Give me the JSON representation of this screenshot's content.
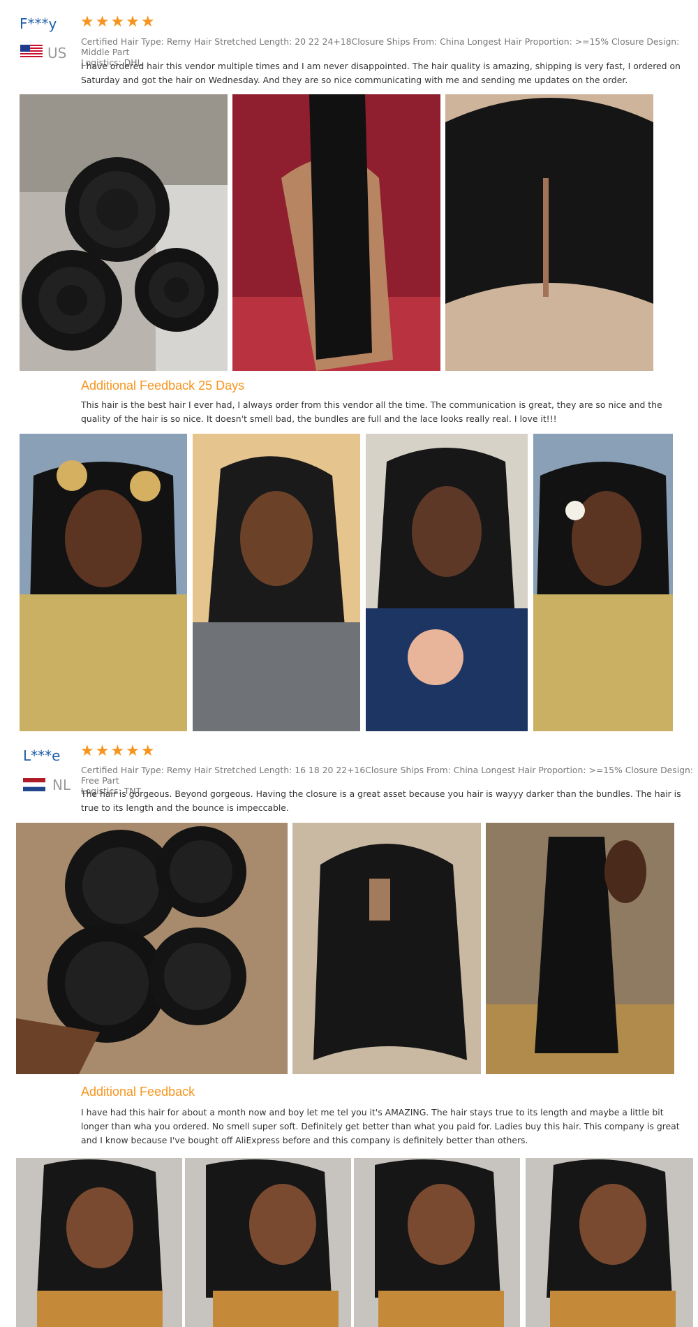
{
  "review1": {
    "reviewer": "F***y",
    "country": "US",
    "stars": "★★★★★",
    "specs": "Certified Hair Type: Remy Hair Stretched Length: 20 22 24+18Closure Ships From: China Longest Hair Proportion: >=15% Closure Design: Middle Part",
    "logistics": "Logistics: DHL",
    "text": "I have ordered hair this vendor multiple times and I am never disappointed. The hair quality is amazing, shipping is very fast, I ordered on Saturday and got the hair on Wednesday. And they are so nice communicating with me and sending me updates on the order.",
    "additional_title": "Additional Feedback 25 Days",
    "additional_text": "This hair is the best hair I ever had, I always order from this vendor all the time. The communication is great, they are so nice and the quality of the hair is so nice. It doesn't smell bad, the bundles are full and the lace looks really real. I love it!!!"
  },
  "review2": {
    "reviewer": "L***e",
    "country": "NL",
    "stars": "★★★★★",
    "specs": "Certified Hair Type: Remy Hair Stretched Length: 16 18 20 22+16Closure Ships From: China Longest Hair Proportion: >=15% Closure Design: Free Part",
    "logistics": "Logistics: TNT",
    "text": "The hair is gorgeous. Beyond gorgeous. Having the closure is a great asset because you hair is wayyy darker than the bundles. The hair is true to its length and the bounce is impeccable.",
    "additional_title": "Additional Feedback",
    "additional_text": "I have had this hair for about a month now and boy let me tel you it's AMAZING. The hair stays true to its length and maybe a little bit longer than wha you ordered. No smell super soft. Definitely get better than what you paid for. Ladies buy this hair. This company is great and I know because I've bought off AliExpress before and this company is definitely better than others."
  },
  "colors": {
    "star": "#f7941d",
    "name": "#1f5fa8",
    "accent": "#f7941d"
  },
  "icons": {
    "us_flag": "us-flag-icon",
    "nl_flag": "nl-flag-icon",
    "star": "star-icon"
  }
}
